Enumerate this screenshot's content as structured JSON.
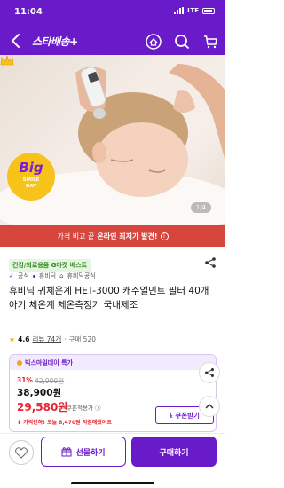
{
  "status": {
    "time": "11:04",
    "network": "LTE"
  },
  "header": {
    "logo": "스타배송+",
    "back_icon": "chevron-left-icon",
    "home_icon": "home-icon",
    "search_icon": "search-icon",
    "cart_icon": "cart-icon"
  },
  "hero": {
    "badge_title": "Big",
    "badge_sub_1": "SMILE",
    "badge_sub_2": "DAY",
    "pager": "1/4"
  },
  "banner": {
    "text_pre": "가격 비교 끝",
    "text_bold": "온라인 최저가 발견!"
  },
  "product": {
    "category_tag": "건강/의료용품 G마켓 베스트",
    "official_label": "공식",
    "brand": "휴비딕",
    "store": "휴비딕공식",
    "title": "휴비딕 귀체온계 HET-3000 캐주얼민트 필터 40개 아기 체온계 체온측정기 국내제조",
    "rating": "4.6",
    "review_label": "리뷰 74개",
    "purchase_label": "구매 520"
  },
  "deal": {
    "header": "빅스마일데이 특가",
    "discount_pct": "31%",
    "original_price": "42,900원",
    "price": "38,900원",
    "coupon_price": "29,580원",
    "coupon_label": "쿠폰적용가",
    "lowest_note": "가격인하! 오늘 8,470원 저렴해졌어요",
    "coupon_button": "쿠폰받기"
  },
  "bottom": {
    "gift_label": "선물하기",
    "buy_label": "구매하기"
  },
  "colors": {
    "brand": "#6a1bc9",
    "sale": "#e8242f",
    "banner": "#d7463d"
  }
}
